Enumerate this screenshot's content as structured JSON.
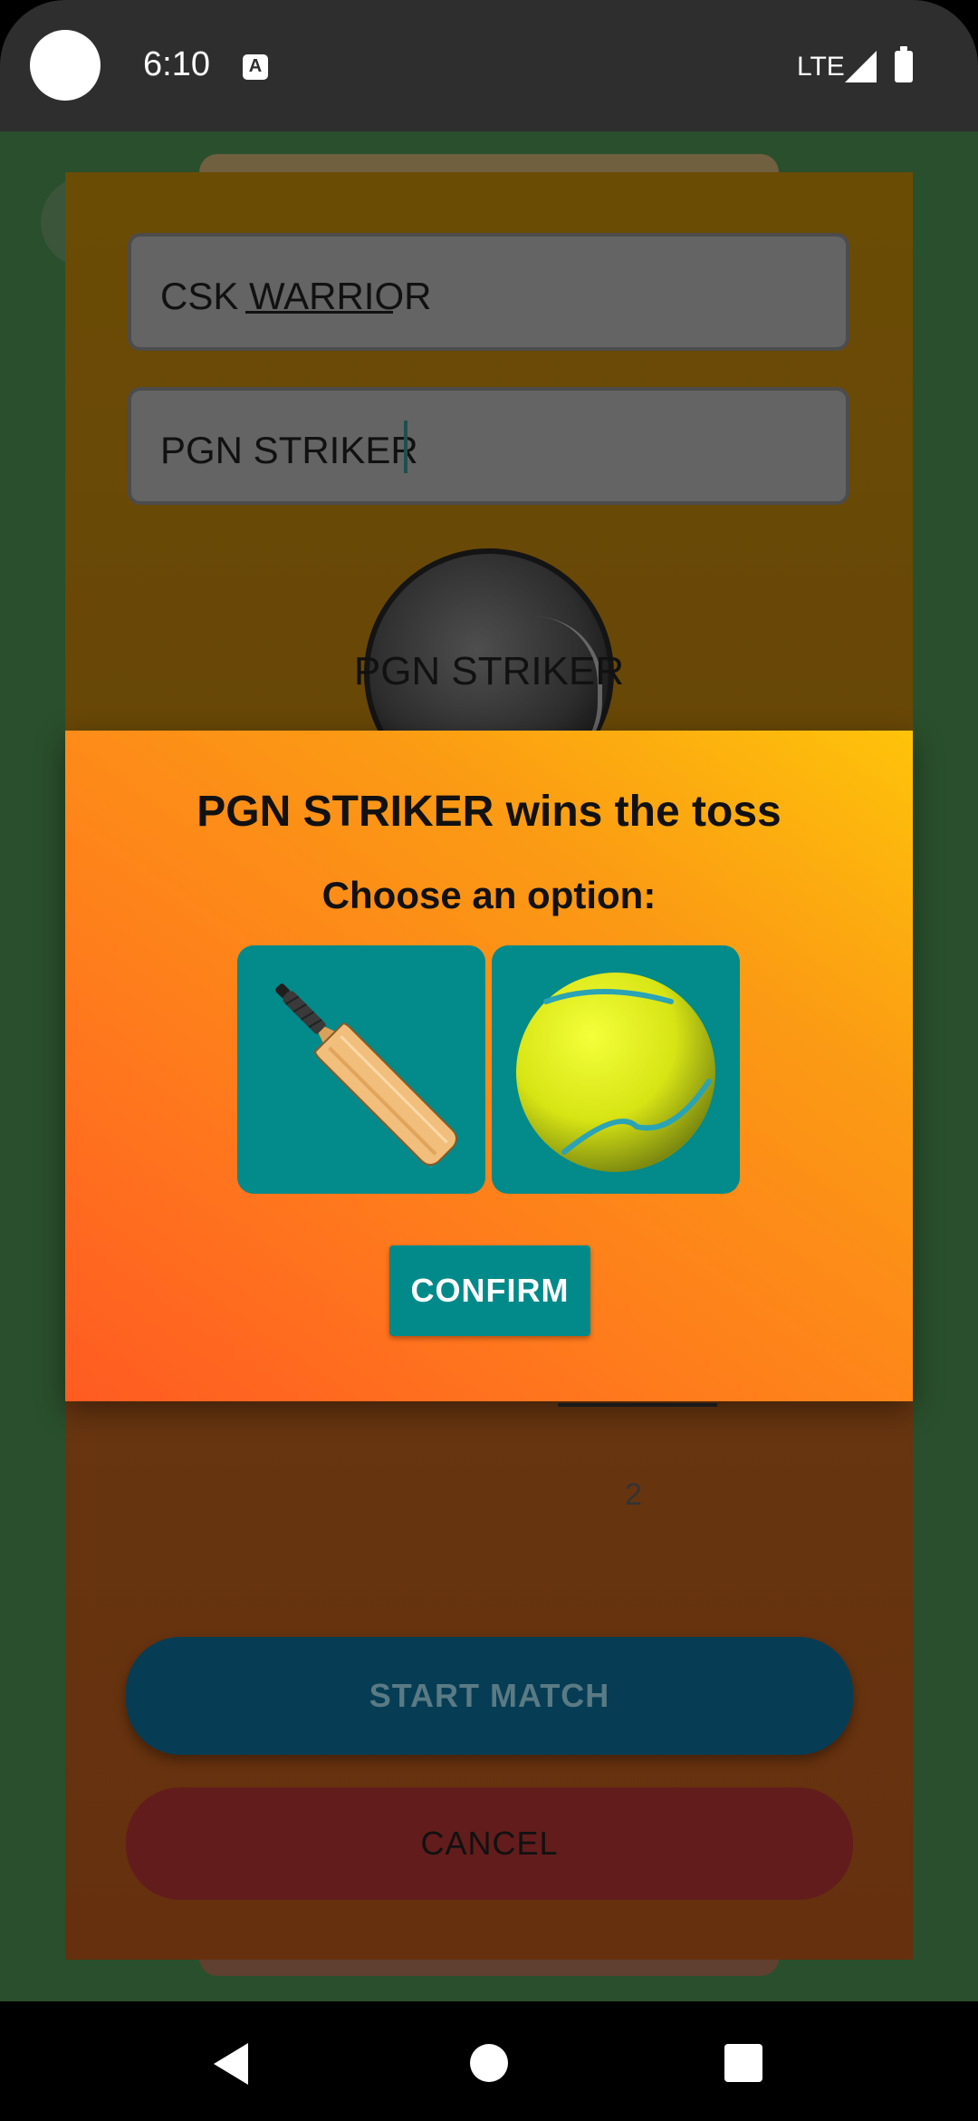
{
  "status_bar": {
    "time": "6:10",
    "notification_icon": "A",
    "network": "LTE",
    "icons": [
      "camera-cutout",
      "signal-icon",
      "battery-icon"
    ]
  },
  "form": {
    "team1_value": "CSK WARRIOR",
    "team2_value": "PGN STRIKER",
    "coin_label": "PGN STRIKER",
    "overs_value": "2",
    "start_button": "START MATCH",
    "cancel_button": "CANCEL"
  },
  "dialog": {
    "title": "PGN STRIKER wins the toss",
    "subtitle": "Choose an option:",
    "options": [
      {
        "icon": "cricket-bat-icon"
      },
      {
        "icon": "tennis-ball-icon"
      }
    ],
    "confirm_button": "CONFIRM"
  },
  "nav": {
    "icons": [
      "back-icon",
      "home-icon",
      "recents-icon"
    ]
  },
  "colors": {
    "dialog_gradient": [
      "#ff5b22",
      "#fec30a"
    ],
    "teal": "#038a8a",
    "start_button": "#063d55",
    "cancel_button": "#621c1c"
  }
}
